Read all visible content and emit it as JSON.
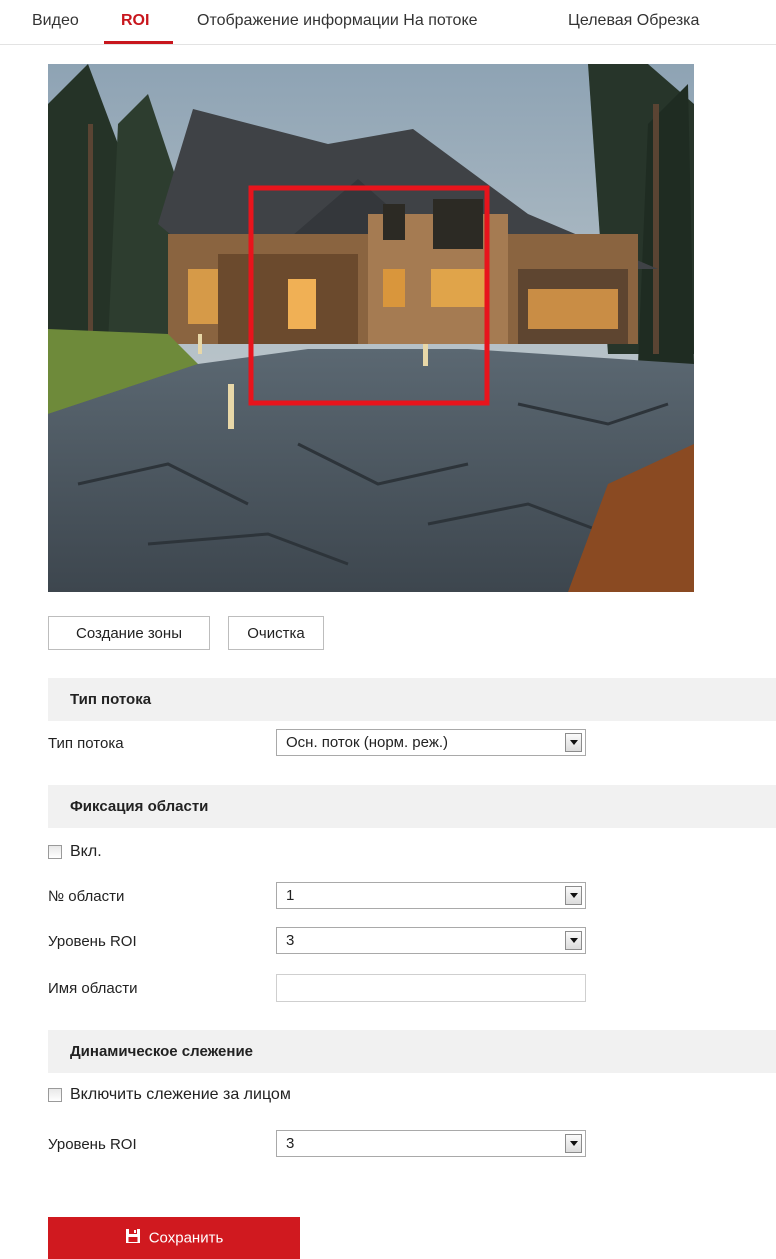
{
  "tabs": [
    {
      "label": "Видео",
      "active": false
    },
    {
      "label": "ROI",
      "active": true
    },
    {
      "label": "Отображение информации На потоке",
      "active": false
    },
    {
      "label": "Целевая Обрезка",
      "active": false
    }
  ],
  "buttons": {
    "create_zone": "Создание зоны",
    "clear": "Очистка",
    "save": "Сохранить"
  },
  "stream_section": {
    "title": "Тип потока",
    "stream_type_label": "Тип потока",
    "stream_type_value": "Осн. поток (норм. реж.)"
  },
  "fixed_section": {
    "title": "Фиксация области",
    "enable_label": "Вкл.",
    "enable_checked": false,
    "area_no_label": "№ области",
    "area_no_value": "1",
    "roi_level_label": "Уровень ROI",
    "roi_level_value": "3",
    "area_name_label": "Имя области",
    "area_name_value": ""
  },
  "dynamic_section": {
    "title": "Динамическое слежение",
    "face_tracking_label": "Включить слежение за лицом",
    "face_tracking_checked": false,
    "roi_level_label": "Уровень ROI",
    "roi_level_value": "3"
  },
  "colors": {
    "accent": "#c8161d",
    "roi_rect": "#e8141c",
    "save_button": "#d0191f"
  },
  "icons": {
    "save": "floppy-disk-icon",
    "dropdown": "chevron-down-icon"
  }
}
